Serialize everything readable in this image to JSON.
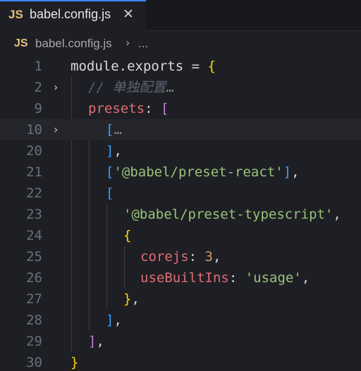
{
  "tab": {
    "lang_badge": "JS",
    "filename": "babel.config.js",
    "close_glyph": "✕"
  },
  "breadcrumb": {
    "lang_badge": "JS",
    "filename": "babel.config.js",
    "separator": "›",
    "more": "..."
  },
  "editor": {
    "lines": [
      {
        "num": "1"
      },
      {
        "num": "2",
        "folded": true
      },
      {
        "num": "9"
      },
      {
        "num": "10",
        "folded": true
      },
      {
        "num": "20"
      },
      {
        "num": "21"
      },
      {
        "num": "22"
      },
      {
        "num": "23"
      },
      {
        "num": "24"
      },
      {
        "num": "25"
      },
      {
        "num": "26"
      },
      {
        "num": "27"
      },
      {
        "num": "28"
      },
      {
        "num": "29"
      },
      {
        "num": "30"
      }
    ],
    "tokens": {
      "l1_a": "module",
      "l1_b": ".",
      "l1_c": "exports",
      "l1_d": " = ",
      "l1_e": "{",
      "l2_comment": "// 单独配置",
      "l2_dots": "…",
      "l9_key": "presets",
      "l9_colon": ": ",
      "l9_br": "[",
      "l10_br": "[",
      "l10_dots": "…",
      "l20_br": "]",
      "l20_comma": ",",
      "l21_br_open": "[",
      "l21_str": "'@babel/preset-react'",
      "l21_br_close": "]",
      "l21_comma": ",",
      "l22_br": "[",
      "l23_str": "'@babel/preset-typescript'",
      "l23_comma": ",",
      "l24_br": "{",
      "l25_key": "corejs",
      "l25_colon": ": ",
      "l25_num": "3",
      "l25_comma": ",",
      "l26_key": "useBuiltIns",
      "l26_colon": ": ",
      "l26_str": "'usage'",
      "l26_comma": ",",
      "l27_br": "}",
      "l27_comma": ",",
      "l28_br": "]",
      "l28_comma": ",",
      "l29_br": "]",
      "l29_comma": ",",
      "l30_br": "}"
    }
  }
}
